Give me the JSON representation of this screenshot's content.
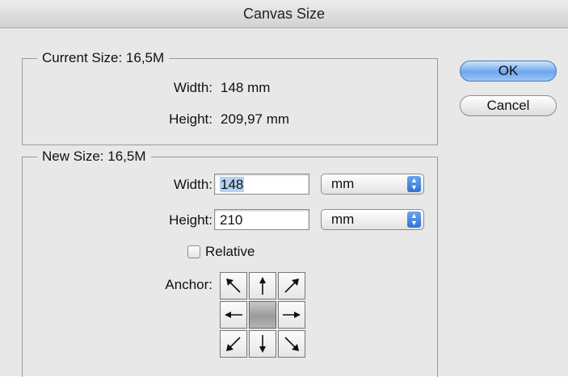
{
  "window": {
    "title": "Canvas Size"
  },
  "current_size": {
    "legend": "Current Size: 16,5M",
    "width_label": "Width:",
    "width_value": "148 mm",
    "height_label": "Height:",
    "height_value": "209,97 mm"
  },
  "new_size": {
    "legend": "New Size: 16,5M",
    "width_label": "Width:",
    "width_value": "148",
    "width_unit": "mm",
    "height_label": "Height:",
    "height_value": "210",
    "height_unit": "mm",
    "relative_label": "Relative",
    "relative_checked": false,
    "anchor_label": "Anchor:",
    "anchor_selected": "center",
    "anchor_icons": [
      "arrow-up-left-icon",
      "arrow-up-icon",
      "arrow-up-right-icon",
      "arrow-left-icon",
      "",
      "arrow-right-icon",
      "arrow-down-left-icon",
      "arrow-down-icon",
      "arrow-down-right-icon"
    ]
  },
  "buttons": {
    "ok_label": "OK",
    "cancel_label": "Cancel"
  },
  "colors": {
    "ok_button": "#6ca6ee",
    "selection": "#b6d2f2",
    "popup_arrow": "#2f72d6"
  }
}
